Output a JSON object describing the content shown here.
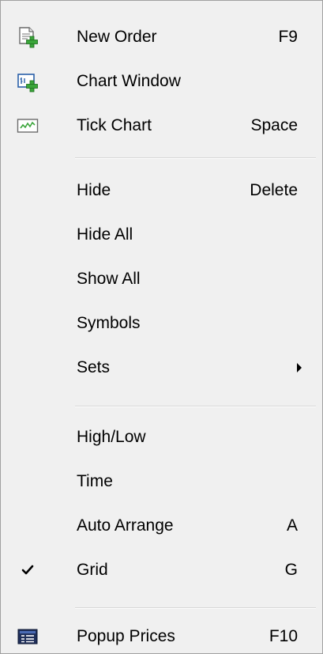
{
  "menu": {
    "new_order": {
      "label": "New Order",
      "shortcut": "F9",
      "icon": "new-order-icon"
    },
    "chart_window": {
      "label": "Chart Window",
      "shortcut": "",
      "icon": "chart-window-icon"
    },
    "tick_chart": {
      "label": "Tick Chart",
      "shortcut": "Space",
      "icon": "tick-chart-icon"
    },
    "hide": {
      "label": "Hide",
      "shortcut": "Delete"
    },
    "hide_all": {
      "label": "Hide All"
    },
    "show_all": {
      "label": "Show All"
    },
    "symbols": {
      "label": "Symbols"
    },
    "sets": {
      "label": "Sets",
      "has_submenu": true
    },
    "high_low": {
      "label": "High/Low"
    },
    "time": {
      "label": "Time"
    },
    "auto_arrange": {
      "label": "Auto Arrange",
      "shortcut": "A"
    },
    "grid": {
      "label": "Grid",
      "shortcut": "G",
      "checked": true
    },
    "popup_prices": {
      "label": "Popup Prices",
      "shortcut": "F10",
      "icon": "popup-prices-icon"
    }
  },
  "colors": {
    "menu_background": "#f0f0f0",
    "separator": "#d7d7d7",
    "icon_green": "#3aa53a",
    "icon_navy": "#1f2f5a"
  }
}
